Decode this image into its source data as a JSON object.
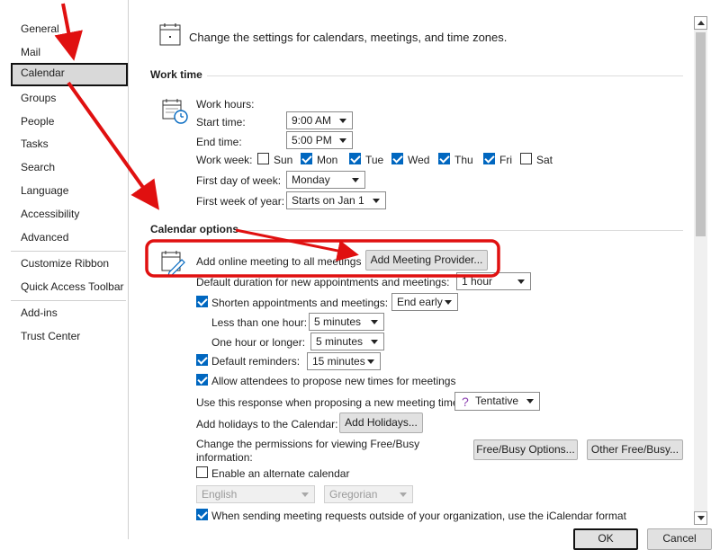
{
  "sidebar": {
    "items": [
      {
        "label": "General"
      },
      {
        "label": "Mail"
      },
      {
        "label": "Calendar"
      },
      {
        "label": "Groups"
      },
      {
        "label": "People"
      },
      {
        "label": "Tasks"
      },
      {
        "label": "Search"
      },
      {
        "label": "Language"
      },
      {
        "label": "Accessibility"
      },
      {
        "label": "Advanced"
      },
      {
        "label": "Customize Ribbon"
      },
      {
        "label": "Quick Access Toolbar"
      },
      {
        "label": "Add-ins"
      },
      {
        "label": "Trust Center"
      }
    ],
    "selected": "Calendar"
  },
  "header": {
    "description": "Change the settings for calendars, meetings, and time zones."
  },
  "work_time": {
    "title": "Work time",
    "work_hours_label": "Work hours:",
    "start_time_label": "Start time:",
    "start_time_value": "9:00 AM",
    "end_time_label": "End time:",
    "end_time_value": "5:00 PM",
    "work_week_label": "Work week:",
    "days": [
      {
        "label": "Sun",
        "checked": false
      },
      {
        "label": "Mon",
        "checked": true
      },
      {
        "label": "Tue",
        "checked": true
      },
      {
        "label": "Wed",
        "checked": true
      },
      {
        "label": "Thu",
        "checked": true
      },
      {
        "label": "Fri",
        "checked": true
      },
      {
        "label": "Sat",
        "checked": false
      }
    ],
    "first_day_label": "First day of week:",
    "first_day_value": "Monday",
    "first_week_label": "First week of year:",
    "first_week_value": "Starts on Jan 1"
  },
  "calendar_options": {
    "title": "Calendar options",
    "add_online_meeting_label": "Add online meeting to all meetings",
    "add_meeting_provider_button": "Add Meeting Provider...",
    "default_duration_label": "Default duration for new appointments and meetings:",
    "default_duration_value": "1 hour",
    "shorten_label": "Shorten appointments and meetings:",
    "shorten_value": "End early",
    "less_than_hour_label": "Less than one hour:",
    "less_than_hour_value": "5 minutes",
    "hour_or_longer_label": "One hour or longer:",
    "hour_or_longer_value": "5 minutes",
    "default_reminders_label": "Default reminders:",
    "default_reminders_value": "15 minutes",
    "allow_attendees_label": "Allow attendees to propose new times for meetings",
    "use_response_label": "Use this response when proposing a new meeting time:",
    "use_response_value": "Tentative",
    "add_holidays_label": "Add holidays to the Calendar:",
    "add_holidays_button": "Add Holidays...",
    "permissions_label_1": "Change the permissions for viewing Free/Busy",
    "permissions_label_2": "information:",
    "free_busy_button": "Free/Busy Options...",
    "other_free_busy_button": "Other Free/Busy...",
    "alternate_calendar_label": "Enable an alternate calendar",
    "alt_language_value": "English",
    "alt_calendar_value": "Gregorian",
    "icalendar_label": "When sending meeting requests outside of your organization, use the iCalendar format"
  },
  "footer": {
    "ok_button": "OK",
    "cancel_button": "Cancel"
  },
  "colors": {
    "checkbox_blue": "#0067c0",
    "annotation_red": "#e01010"
  }
}
